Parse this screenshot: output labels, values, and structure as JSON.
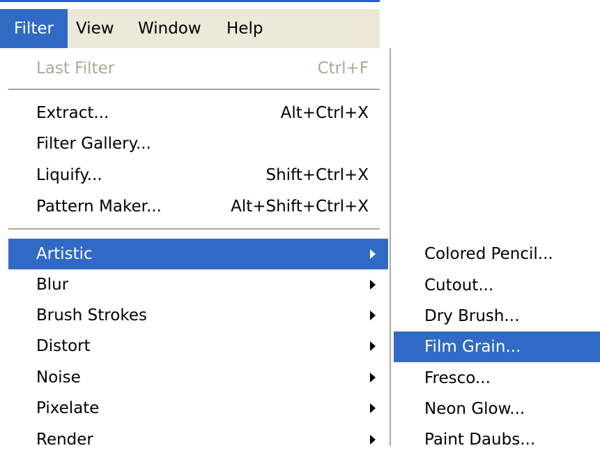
{
  "menubar": {
    "items": [
      {
        "label": "Filter",
        "active": true
      },
      {
        "label": "View"
      },
      {
        "label": "Window"
      },
      {
        "label": "Help"
      }
    ]
  },
  "filter_menu": {
    "last_filter": {
      "label": "Last Filter",
      "shortcut": "Ctrl+F"
    },
    "extract": {
      "label": "Extract...",
      "shortcut": "Alt+Ctrl+X"
    },
    "filter_gallery": {
      "label": "Filter Gallery..."
    },
    "liquify": {
      "label": "Liquify...",
      "shortcut": "Shift+Ctrl+X"
    },
    "pattern_maker": {
      "label": "Pattern Maker...",
      "shortcut": "Alt+Shift+Ctrl+X"
    },
    "categories": [
      {
        "label": "Artistic"
      },
      {
        "label": "Blur"
      },
      {
        "label": "Brush Strokes"
      },
      {
        "label": "Distort"
      },
      {
        "label": "Noise"
      },
      {
        "label": "Pixelate"
      },
      {
        "label": "Render"
      }
    ]
  },
  "artistic_submenu": {
    "items": [
      {
        "label": "Colored Pencil..."
      },
      {
        "label": "Cutout..."
      },
      {
        "label": "Dry Brush..."
      },
      {
        "label": "Film Grain..."
      },
      {
        "label": "Fresco..."
      },
      {
        "label": "Neon Glow..."
      },
      {
        "label": "Paint Daubs..."
      }
    ]
  },
  "colors": {
    "highlight": "#316ac5",
    "menubar_bg": "#ece9d8",
    "disabled_text": "#aca899"
  }
}
